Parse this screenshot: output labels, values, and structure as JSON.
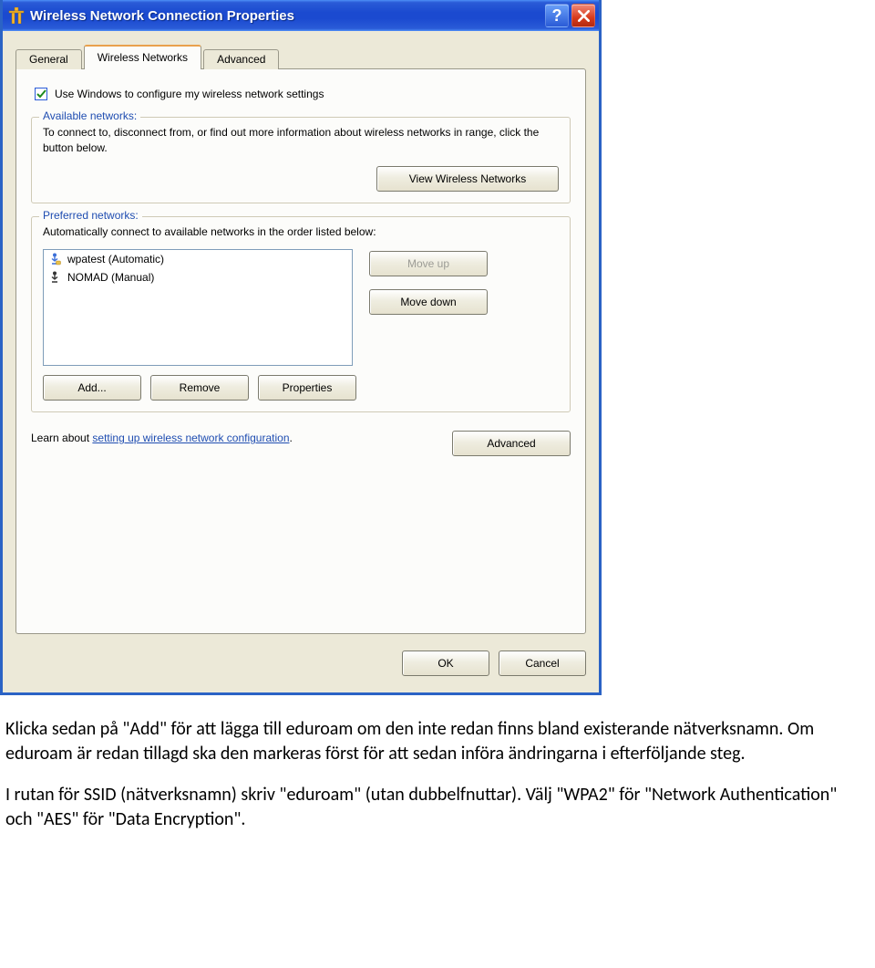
{
  "window": {
    "title": "Wireless Network Connection Properties",
    "tabs": {
      "general": "General",
      "wireless_networks": "Wireless Networks",
      "advanced": "Advanced"
    },
    "checkbox_use_windows": "Use Windows to configure my wireless network settings",
    "available": {
      "legend": "Available networks:",
      "text": "To connect to, disconnect from, or find out more information about wireless networks in range, click the button below.",
      "view_btn": "View Wireless Networks"
    },
    "preferred": {
      "legend": "Preferred networks:",
      "text": "Automatically connect to available networks in the order listed below:",
      "items": [
        {
          "label": "wpatest (Automatic)"
        },
        {
          "label": "NOMAD (Manual)"
        }
      ],
      "move_up": "Move up",
      "move_down": "Move down",
      "add": "Add...",
      "remove": "Remove",
      "properties": "Properties"
    },
    "learn": {
      "prefix": "Learn about ",
      "link": "setting up wireless network configuration",
      "suffix": "."
    },
    "advanced_btn": "Advanced",
    "ok": "OK",
    "cancel": "Cancel"
  },
  "doc": {
    "p1": "Klicka sedan på \"Add\" för att lägga till eduroam om den inte redan finns bland existerande nätverksnamn. Om eduroam är redan tillagd ska den markeras först för att sedan införa ändringarna i efterföljande steg.",
    "p2": "I rutan för SSID (nätverksnamn) skriv \"eduroam\" (utan dubbelfnuttar). Välj \"WPA2\" för \"Network Authentication\" och \"AES\" för \"Data Encryption\"."
  }
}
